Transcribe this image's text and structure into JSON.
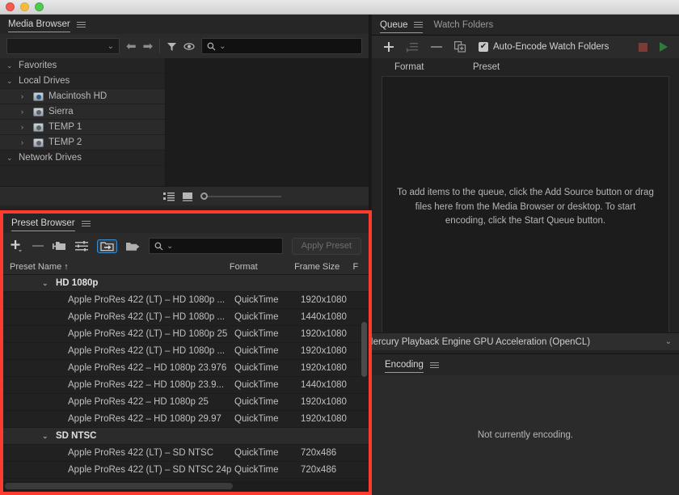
{
  "window": {
    "lights": [
      "close",
      "minimize",
      "zoom"
    ]
  },
  "media_browser": {
    "title": "Media Browser",
    "menu_icon": "hamburger-icon",
    "toolbar": {
      "path_select_value": "",
      "back_icon": "arrow-left-icon",
      "forward_icon": "arrow-right-icon",
      "filter_icon": "funnel-icon",
      "visibility_icon": "eye-icon",
      "search_icon": "search-icon",
      "search_value": ""
    },
    "tree": [
      {
        "label": "Favorites",
        "level": 0,
        "twisty": "chevron-down",
        "icon": null
      },
      {
        "label": "Local Drives",
        "level": 0,
        "twisty": "chevron-down",
        "icon": null
      },
      {
        "label": "Macintosh HD",
        "level": 1,
        "twisty": "chevron-right",
        "icon": "hard-drive-icon"
      },
      {
        "label": "Sierra",
        "level": 1,
        "twisty": "chevron-right",
        "icon": "hard-drive-icon"
      },
      {
        "label": "TEMP 1",
        "level": 1,
        "twisty": "chevron-right",
        "icon": "hard-drive-icon"
      },
      {
        "label": "TEMP 2",
        "level": 1,
        "twisty": "chevron-right",
        "icon": "hard-drive-icon"
      },
      {
        "label": "Network Drives",
        "level": 0,
        "twisty": "chevron-down",
        "icon": null
      }
    ],
    "bottom": {
      "list_view_icon": "list-view-icon",
      "thumbnail_view_icon": "thumbnail-view-icon",
      "zoom_slider_value": 0
    }
  },
  "queue": {
    "tabs": [
      {
        "label": "Queue",
        "active": true,
        "menu_icon": "hamburger-icon"
      },
      {
        "label": "Watch Folders",
        "active": false,
        "menu_icon": null
      }
    ],
    "toolbar": {
      "add_source_icon": "plus-icon",
      "add_preset_icon": "add-preset-icon",
      "remove_icon": "minus-icon",
      "duplicate_icon": "duplicate-icon",
      "auto_encode_label": "Auto-Encode Watch Folders",
      "auto_encode_checked": true,
      "checkmark": "✔",
      "stop_icon": "stop-icon",
      "start_icon": "play-icon"
    },
    "columns": [
      "Format",
      "Preset"
    ],
    "empty_message": "To add items to the queue, click the Add Source button or drag files here from the Media Browser or desktop.  To start encoding, click the Start Queue button.",
    "gpu_renderer": "Mercury Playback Engine GPU Acceleration (OpenCL)",
    "gpu_chevron_icon": "chevron-down-icon"
  },
  "preset_browser": {
    "title": "Preset Browser",
    "menu_icon": "hamburger-icon",
    "toolbar": {
      "new_preset_icon": "plus-icon",
      "delete_preset_icon": "minus-icon",
      "new_folder_icon": "new-folder-icon",
      "settings_icon": "preset-settings-icon",
      "import_icon": "import-preset-icon",
      "import_selected": true,
      "export_icon": "export-preset-icon",
      "search_icon": "search-icon",
      "search_value": "",
      "apply_label": "Apply Preset",
      "apply_disabled": true
    },
    "columns": [
      {
        "label": "Preset Name",
        "sort": "↑"
      },
      {
        "label": "Format"
      },
      {
        "label": "Frame Size"
      },
      {
        "label": "F"
      }
    ],
    "rows": [
      {
        "type": "group",
        "name": "HD 1080p",
        "twisty": "chevron-down",
        "format": "",
        "frame_size": ""
      },
      {
        "type": "preset",
        "name": "Apple ProRes 422 (LT) – HD 1080p ...",
        "format": "QuickTime",
        "frame_size": "1920x1080"
      },
      {
        "type": "preset",
        "name": "Apple ProRes 422 (LT) – HD 1080p ...",
        "format": "QuickTime",
        "frame_size": "1440x1080"
      },
      {
        "type": "preset",
        "name": "Apple ProRes 422 (LT) – HD 1080p 25",
        "format": "QuickTime",
        "frame_size": "1920x1080"
      },
      {
        "type": "preset",
        "name": "Apple ProRes 422 (LT) – HD 1080p ...",
        "format": "QuickTime",
        "frame_size": "1920x1080"
      },
      {
        "type": "preset",
        "name": "Apple ProRes 422 – HD 1080p 23.976",
        "format": "QuickTime",
        "frame_size": "1920x1080"
      },
      {
        "type": "preset",
        "name": "Apple ProRes 422 – HD 1080p 23.9...",
        "format": "QuickTime",
        "frame_size": "1440x1080"
      },
      {
        "type": "preset",
        "name": "Apple ProRes 422 – HD 1080p 25",
        "format": "QuickTime",
        "frame_size": "1920x1080"
      },
      {
        "type": "preset",
        "name": "Apple ProRes 422 – HD 1080p 29.97",
        "format": "QuickTime",
        "frame_size": "1920x1080"
      },
      {
        "type": "group",
        "name": "SD NTSC",
        "twisty": "chevron-down",
        "format": "",
        "frame_size": ""
      },
      {
        "type": "preset",
        "name": "Apple ProRes 422 (LT) – SD NTSC",
        "format": "QuickTime",
        "frame_size": "720x486"
      },
      {
        "type": "preset",
        "name": "Apple ProRes 422 (LT) – SD NTSC 24p",
        "format": "QuickTime",
        "frame_size": "720x486"
      }
    ],
    "highlight_color": "#ff3b30"
  },
  "encoding": {
    "title": "Encoding",
    "menu_icon": "hamburger-icon",
    "status": "Not currently encoding."
  }
}
